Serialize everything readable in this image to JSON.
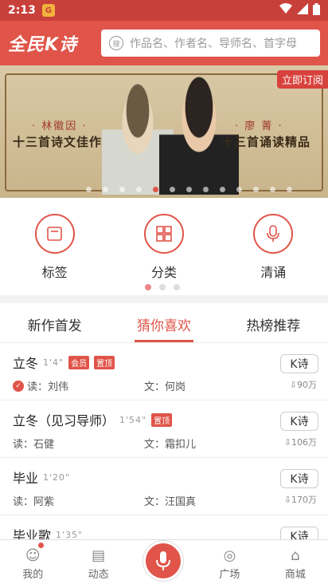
{
  "status": {
    "time": "2:13",
    "app_badge": "G"
  },
  "header": {
    "logo": "全民K诗",
    "search_placeholder": "作品名、作者名、导师名、首字母",
    "search_icon_text": "搜"
  },
  "banner": {
    "subscribe": "立即订阅",
    "name_left": "· 林徽因 ·",
    "name_right": "· 廖 菁 ·",
    "text_left": "十三首诗文佳作",
    "text_right": "十三首诵读精品"
  },
  "categories": [
    {
      "label": "标签",
      "icon": "tag-icon"
    },
    {
      "label": "分类",
      "icon": "grid-icon"
    },
    {
      "label": "清诵",
      "icon": "mic-icon"
    }
  ],
  "tabs": [
    {
      "label": "新作首发"
    },
    {
      "label": "猜你喜欢"
    },
    {
      "label": "热榜推荐"
    }
  ],
  "items": [
    {
      "title": "立冬",
      "duration": "1'4\"",
      "tags": [
        "会员",
        "置顶"
      ],
      "reader": "读：刘伟",
      "author": "文：何岗",
      "k": "K诗",
      "downloads": "90万",
      "checked": true
    },
    {
      "title": "立冬（见习导师）",
      "duration": "1'54\"",
      "tags": [
        "置顶"
      ],
      "reader": "读：石健",
      "author": "文：霜扣儿",
      "k": "K诗",
      "downloads": "106万"
    },
    {
      "title": "毕业",
      "duration": "1'20\"",
      "tags": [],
      "reader": "读：阿紫",
      "author": "文：汪国真",
      "k": "K诗",
      "downloads": "170万"
    },
    {
      "title": "毕业歌",
      "duration": "1'35\"",
      "tags": [],
      "reader": "",
      "author": "",
      "k": "K诗",
      "downloads": ""
    }
  ],
  "bottom_nav": [
    {
      "label": "我的",
      "icon": "profile-icon"
    },
    {
      "label": "动态",
      "icon": "feed-icon"
    },
    {
      "label": "",
      "icon": "mic-icon"
    },
    {
      "label": "广场",
      "icon": "compass-icon"
    },
    {
      "label": "商城",
      "icon": "shop-icon"
    }
  ],
  "colors": {
    "accent": "#e05449",
    "status_bar": "#c8403a"
  }
}
